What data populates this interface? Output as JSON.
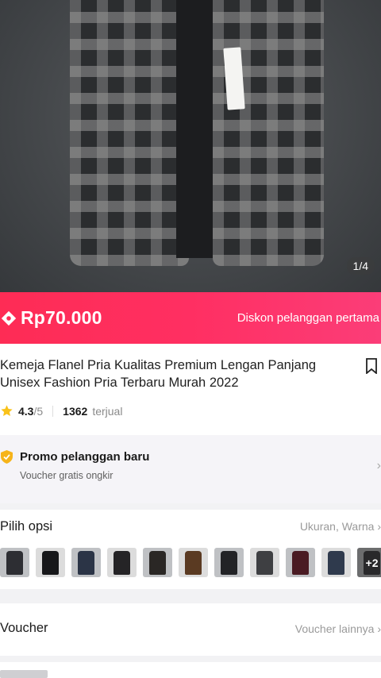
{
  "gallery": {
    "counter": "1/4"
  },
  "price_bar": {
    "price": "Rp70.000",
    "promo": "Diskon pelanggan pertama"
  },
  "product": {
    "title": "Kemeja Flanel Pria Kualitas Premium Lengan Panjang Unisex Fashion Pria Terbaru Murah 2022",
    "rating": "4.3",
    "rating_max": "/5",
    "sold_count": "1362",
    "sold_label": "terjual"
  },
  "promo": {
    "title": "Promo pelanggan baru",
    "subtitle": "Voucher gratis ongkir"
  },
  "options": {
    "title": "Pilih opsi",
    "summary": "Ukuran, Warna",
    "more_label": "+2",
    "thumb_colors": [
      "#2d2e33",
      "#17181a",
      "#2b3446",
      "#252426",
      "#2a2725",
      "#5a3a22",
      "#222326",
      "#3e3f42",
      "#4a1b23",
      "#2f3a4d",
      "#2c2c30"
    ]
  },
  "voucher": {
    "title": "Voucher",
    "more": "Voucher lainnya"
  },
  "colors": {
    "accent": "#fe2c55",
    "star": "#f9c21a",
    "shield": "#f6b41a"
  }
}
